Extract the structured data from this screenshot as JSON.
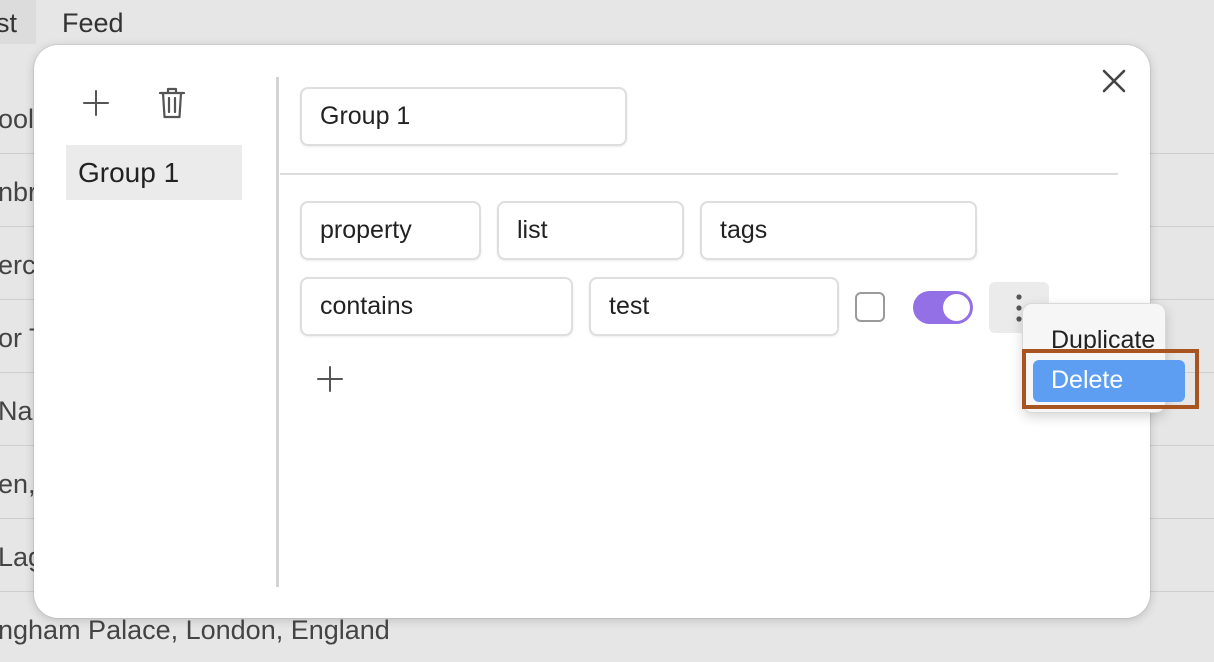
{
  "background": {
    "tabs": [
      "st",
      "Feed"
    ],
    "rows": [
      "ooli",
      "nbr",
      "erc",
      "or T",
      "Na",
      "en,",
      "Lag",
      "ngham Palace, London, England"
    ]
  },
  "modal": {
    "close_icon": "close-icon",
    "sidebar": {
      "add_icon": "plus-icon",
      "delete_icon": "trash-icon",
      "groups": [
        {
          "label": "Group 1"
        }
      ]
    },
    "group_name": "Group 1",
    "rule": {
      "source": "property",
      "type": "list",
      "property": "tags",
      "operator": "contains",
      "value": "test",
      "checkbox_checked": false,
      "toggle_on": true
    },
    "add_rule_icon": "plus-icon"
  },
  "context_menu": {
    "items": [
      {
        "label": "Duplicate"
      },
      {
        "label": "Delete"
      }
    ],
    "selected": "Delete"
  },
  "colors": {
    "toggle_on": "#9370e6",
    "menu_selected": "#5d9ef3",
    "highlight": "#a85420"
  }
}
